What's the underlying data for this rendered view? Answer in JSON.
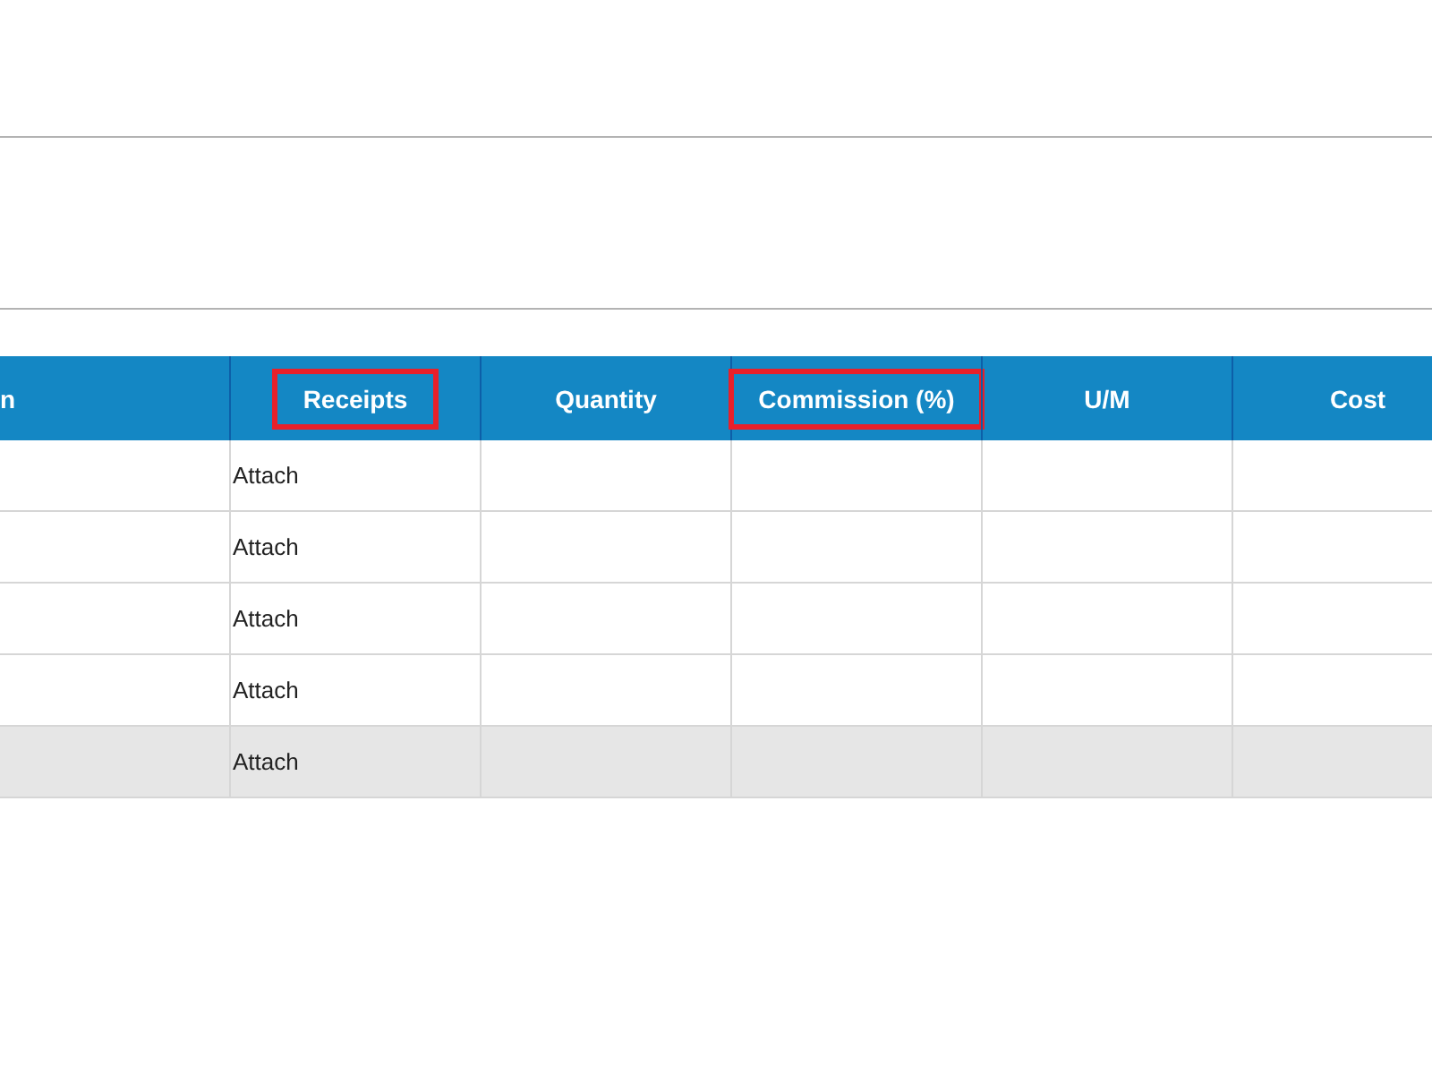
{
  "table": {
    "columns": [
      {
        "label": "n",
        "highlighted": false
      },
      {
        "label": "Receipts",
        "highlighted": true
      },
      {
        "label": "Quantity",
        "highlighted": false
      },
      {
        "label": "Commission (%)",
        "highlighted": true
      },
      {
        "label": "U/M",
        "highlighted": false
      },
      {
        "label": "Cost",
        "highlighted": false
      }
    ],
    "rows": [
      {
        "receipts": "Attach",
        "selected": false
      },
      {
        "receipts": "Attach",
        "selected": false
      },
      {
        "receipts": "Attach",
        "selected": false
      },
      {
        "receipts": "Attach",
        "selected": false
      },
      {
        "receipts": "Attach",
        "selected": true
      }
    ]
  }
}
